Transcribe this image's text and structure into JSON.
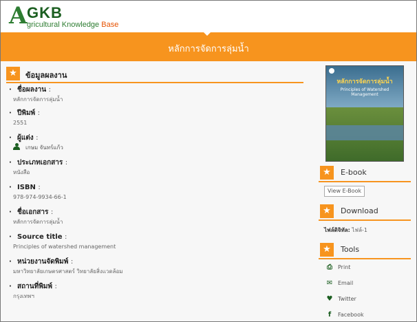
{
  "header": {
    "logo_big": "A",
    "logo_kb": "GKB",
    "logo_sub_green": "gricultural Knowledge ",
    "logo_sub_orange": "Base",
    "banner_title": "หลักการจัดการลุ่มน้ำ"
  },
  "main": {
    "section_title": "ข้อมูลผลงาน",
    "fields": [
      {
        "label": "ชื่อผลงาน",
        "value": "หลักการจัดการลุ่มน้ำ"
      },
      {
        "label": "ปีพิมพ์",
        "value": "2551"
      },
      {
        "label": "ผู้แต่ง",
        "value": "เกษม จันทร์แก้ว"
      },
      {
        "label": "ประเภทเอกสาร",
        "value": "หนังสือ"
      },
      {
        "label": "ISBN",
        "value": "978-974-9934-66-1"
      },
      {
        "label": "ชื่อเอกสาร",
        "value": "หลักการจัดการลุ่มน้ำ"
      },
      {
        "label": "Source title",
        "value": "Principles of watershed management"
      },
      {
        "label": "หน่วยงานจัดพิมพ์",
        "value": "มหาวิทยาลัยเกษตรศาสตร์ วิทยาลัยสิ่งแวดล้อม"
      },
      {
        "label": "สถานที่พิมพ์",
        "value": "กรุงเทพฯ"
      }
    ]
  },
  "side": {
    "cover_title": "หลักการจัดการลุ่มน้ำ",
    "cover_sub": "Principles of Watershed Management",
    "ebook_title": "E-book",
    "ebook_button": "View E-Book",
    "download_title": "Download",
    "download_label": "ไฟล์ดิจิทัล:",
    "download_file": "ไฟล์-1",
    "tools_title": "Tools",
    "tools": {
      "print": "Print",
      "email": "Email",
      "twitter": "Twitter",
      "facebook": "Facebook"
    }
  },
  "colors": {
    "accent": "#f7941e",
    "brand_green": "#2e7d32"
  }
}
